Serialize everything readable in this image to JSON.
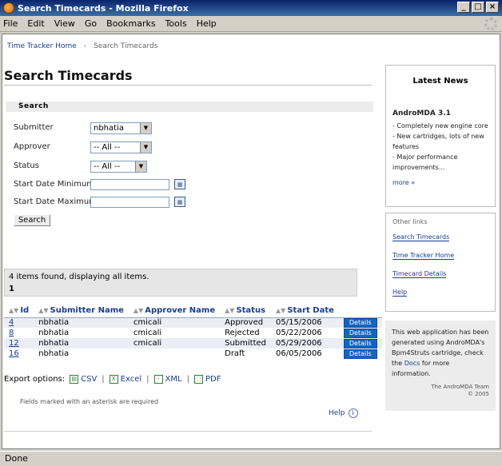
{
  "window": {
    "title": "Search Timecards - Mozilla Firefox"
  },
  "menu": [
    "File",
    "Edit",
    "View",
    "Go",
    "Bookmarks",
    "Tools",
    "Help"
  ],
  "breadcrumb": {
    "home": "Time Tracker Home",
    "current": "Search Timecards"
  },
  "page": {
    "title": "Search Timecards"
  },
  "search": {
    "section_title": "Search",
    "submitter_label": "Submitter",
    "submitter_value": "nbhatia",
    "approver_label": "Approver",
    "approver_value": "-- All --",
    "status_label": "Status",
    "status_value": "-- All --",
    "start_min_label": "Start Date Minimum",
    "start_max_label": "Start Date Maximum",
    "button": "Search"
  },
  "results": {
    "summary": "4 items found, displaying all items.",
    "page": "1",
    "columns": [
      "Id",
      "Submitter Name",
      "Approver Name",
      "Status",
      "Start Date"
    ],
    "rows": [
      {
        "id": "4",
        "submitter": "nbhatia",
        "approver": "cmicali",
        "status": "Approved",
        "start": "05/15/2006",
        "action": "Details"
      },
      {
        "id": "8",
        "submitter": "nbhatia",
        "approver": "cmicali",
        "status": "Rejected",
        "start": "05/22/2006",
        "action": "Details"
      },
      {
        "id": "12",
        "submitter": "nbhatia",
        "approver": "cmicali",
        "status": "Submitted",
        "start": "05/29/2006",
        "action": "Details"
      },
      {
        "id": "16",
        "submitter": "nbhatia",
        "approver": "",
        "status": "Draft",
        "start": "06/05/2006",
        "action": "Details"
      }
    ]
  },
  "export": {
    "label": "Export options:",
    "csv": "CSV",
    "excel": "Excel",
    "xml": "XML",
    "pdf": "PDF",
    "sep": "|"
  },
  "footnote": "Fields marked with an asterisk are required",
  "help": "Help",
  "news": {
    "title": "Latest News",
    "headline": "AndroMDA 3.1",
    "lines": [
      "- Completely new engine core",
      "- New cartridges, lots of new features",
      "- Major performance improvements..."
    ],
    "more": "more »"
  },
  "links": {
    "title": "Other links",
    "items": [
      "Search Timecards",
      "Time Tracker Home",
      "Timecard Details",
      "Help"
    ]
  },
  "generated": {
    "text_1": "This web application has been generated using AndroMDA's Bpm4Struts cartridge, check the",
    "docs": "Docs",
    "text_2": "for more information.",
    "team": "The AndroMDA Team",
    "year": "© 2005"
  },
  "status_bar": "Done"
}
